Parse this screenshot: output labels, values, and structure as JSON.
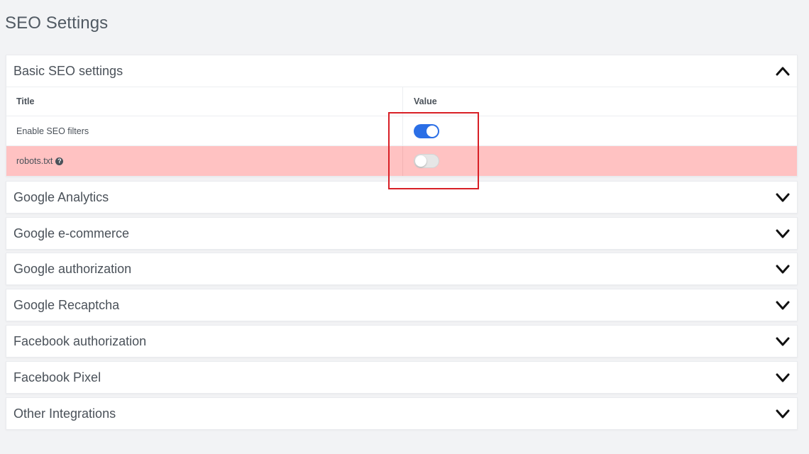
{
  "page": {
    "title": "SEO Settings"
  },
  "basic": {
    "title": "Basic SEO settings",
    "columns": {
      "title": "Title",
      "value": "Value"
    },
    "rows": [
      {
        "label": "Enable SEO filters",
        "enabled": true
      },
      {
        "label": "robots.txt",
        "enabled": false,
        "help_icon": "question-circle-icon"
      }
    ]
  },
  "sections": [
    {
      "title": "Google Analytics"
    },
    {
      "title": "Google e-commerce"
    },
    {
      "title": "Google authorization"
    },
    {
      "title": "Google Recaptcha"
    },
    {
      "title": "Facebook authorization"
    },
    {
      "title": "Facebook Pixel"
    },
    {
      "title": "Other Integrations"
    }
  ],
  "colors": {
    "toggle_on": "#2b6fe6",
    "error_row": "#ffc2c2",
    "highlight": "#d81f26"
  }
}
